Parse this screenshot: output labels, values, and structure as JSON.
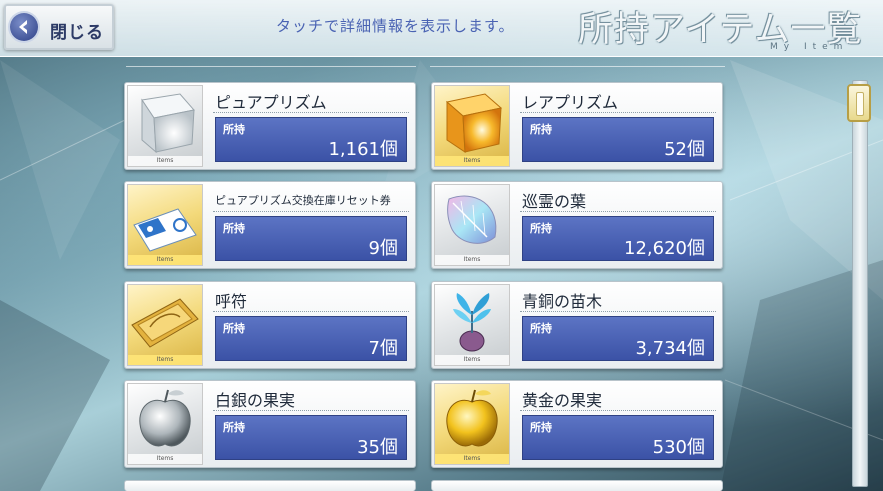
{
  "header": {
    "close_label": "閉じる",
    "hint": "タッチで詳細情報を表示します。",
    "title": "所持アイテム一覧",
    "subtitle": "My Item"
  },
  "items": [
    {
      "name": "ピュアプリズム",
      "own_label": "所持",
      "count": "1,161個",
      "thumb_tag": "Items"
    },
    {
      "name": "レアプリズム",
      "own_label": "所持",
      "count": "52個",
      "thumb_tag": "Items"
    },
    {
      "name": "ピュアプリズム交換在庫リセット券",
      "own_label": "所持",
      "count": "9個",
      "thumb_tag": "Items"
    },
    {
      "name": "巡霊の葉",
      "own_label": "所持",
      "count": "12,620個",
      "thumb_tag": "Items"
    },
    {
      "name": "呼符",
      "own_label": "所持",
      "count": "7個",
      "thumb_tag": "Items"
    },
    {
      "name": "青銅の苗木",
      "own_label": "所持",
      "count": "3,734個",
      "thumb_tag": "Items"
    },
    {
      "name": "白銀の果実",
      "own_label": "所持",
      "count": "35個",
      "thumb_tag": "Items"
    },
    {
      "name": "黄金の果実",
      "own_label": "所持",
      "count": "530個",
      "thumb_tag": "Items"
    }
  ],
  "colors": {
    "accent": "#3b52a6",
    "hint_text": "#4a63b3",
    "gold_frame": "#d9b444"
  }
}
